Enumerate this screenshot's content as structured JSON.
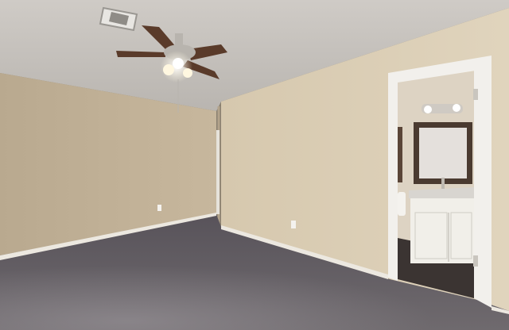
{
  "scene": {
    "description_free": true,
    "colors": {
      "ceiling": "#cfcbc6",
      "ceiling_shadow": "#b9b5b0",
      "left_wall": "#c7b79d",
      "left_wall_shadow": "#b9a98f",
      "back_wall": "#d6c8ae",
      "back_wall_light": "#e0d4bd",
      "baseboard": "#ece8e0",
      "carpet": "#6f6a6e",
      "carpet_dark": "#58535a",
      "carpet_light": "#8a858a",
      "door_frame": "#f2f0ec",
      "bath_wall": "#ddd3c3",
      "bath_floor": "#3b3432",
      "vanity": "#f1efe9",
      "mirror_frame": "#4a3a30",
      "mirror_glass": "#e4e0dc",
      "fan_blade": "#5a3b2a",
      "fan_metal": "#b8b4ae",
      "light_glow": "#fff7e0",
      "vent": "#9a9792",
      "outlet": "#f4f2ee"
    }
  }
}
